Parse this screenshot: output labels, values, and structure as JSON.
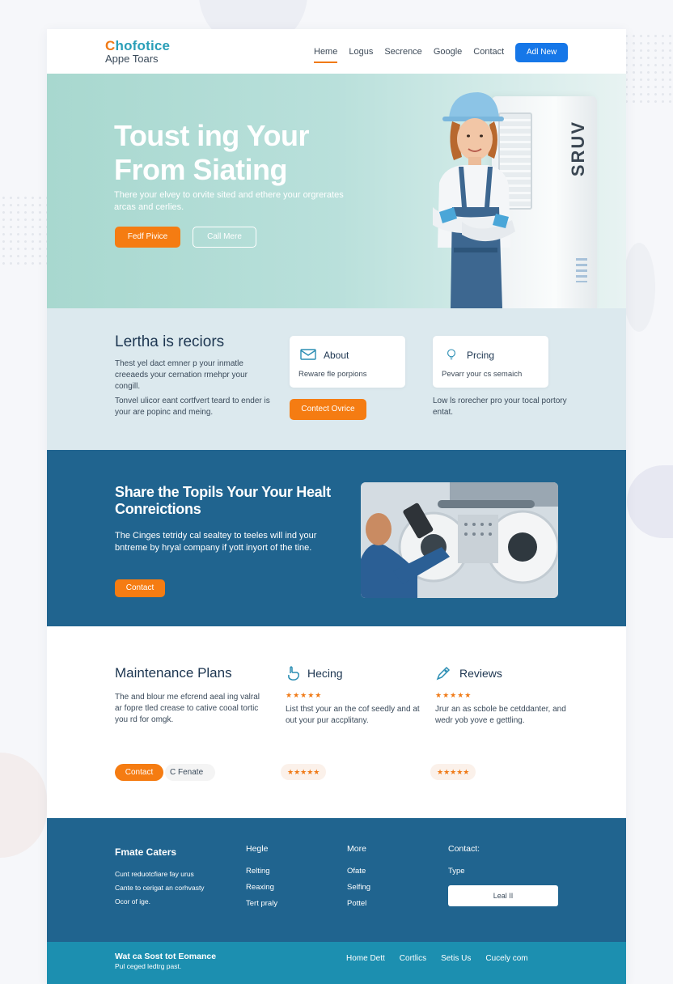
{
  "brand": {
    "logo_top": "hofotice",
    "logo_c": "C",
    "logo_bottom": "Appe Toars"
  },
  "nav": {
    "items": [
      "Heme",
      "Logus",
      "Secrence",
      "Google",
      "Contact"
    ],
    "cta": "Adl New"
  },
  "hero": {
    "headline": "Toust ing Your From Siating",
    "body": "There your elvey to orvite sited and ethere your orgrerates arcas and cerlies.",
    "primary_button": "Fedf Pivice",
    "secondary_button": "Call Mere",
    "unit_brand": "SRUV"
  },
  "about_section": {
    "title": "Lertha is reciors",
    "paragraph1": "Thest yel dact emner p your inmatle creeaeds your cernation rmehpr your congill.",
    "paragraph2": "Tonvel ulicor eant cortfvert teard to ender is your are popinc and meing.",
    "card_about": {
      "title": "About",
      "subtitle": "Reware fle porpions"
    },
    "card_pricing": {
      "title": "Prcing",
      "subtitle": "Pevarr your cs semaich"
    },
    "button": "Contect Ovrice",
    "right_text": "Low ls rorecher pro your tocal portory entat."
  },
  "feature_section": {
    "title": "Share the Topils Your Your Healt Conreictions",
    "body": "The Cinges tetridy cal sealtey to teeles will ind your bntreme by hryal company if yott inyort of the tine.",
    "button": "Contact"
  },
  "plans_section": {
    "columns": [
      {
        "title": "Maintenance Plans",
        "body": "The and blour me efcrend aeal ing valral ar fopre tled crease to cative cooal tortic you rd for omgk."
      },
      {
        "title": "Hecing",
        "stars": "★★★★★",
        "body": "List thst your an the cof seedly and at out your pur accplitany.",
        "pill": "★★★★★"
      },
      {
        "title": "Reviews",
        "stars": "★★★★★",
        "body": "Jrur an as scbole be cetddanter, and wedr yob yove e gettling.",
        "pill": "★★★★★"
      }
    ],
    "button_primary": "Contact",
    "button_secondary": "C Fenate"
  },
  "footer": {
    "col1_title": "Fmate Caters",
    "col1_lines": [
      "Cunt reduotcfiare fay urus",
      "Cante to cerigat an corhvasty",
      "Ocor of ige."
    ],
    "col2_title": "Hegle",
    "col2_items": [
      "Relting",
      "Reaxing",
      "Tert praly"
    ],
    "col3_title": "More",
    "col3_items": [
      "Ofate",
      "Selfing",
      "Pottel"
    ],
    "col4_title": "Contact:",
    "col4_sub": "Type",
    "input_label": "Leal II"
  },
  "bottom_bar": {
    "title": "Wat ca Sost tot Eomance",
    "subtitle": "Pul ceged ledtrg past.",
    "links": [
      "Home Dett",
      "Cortlics",
      "Setis Us",
      "Cucely com"
    ]
  },
  "colors": {
    "accent": "#f57c12",
    "primary_blue": "#1677e8",
    "dark_teal": "#20648f",
    "hero_mint": "#a8d8cf"
  }
}
